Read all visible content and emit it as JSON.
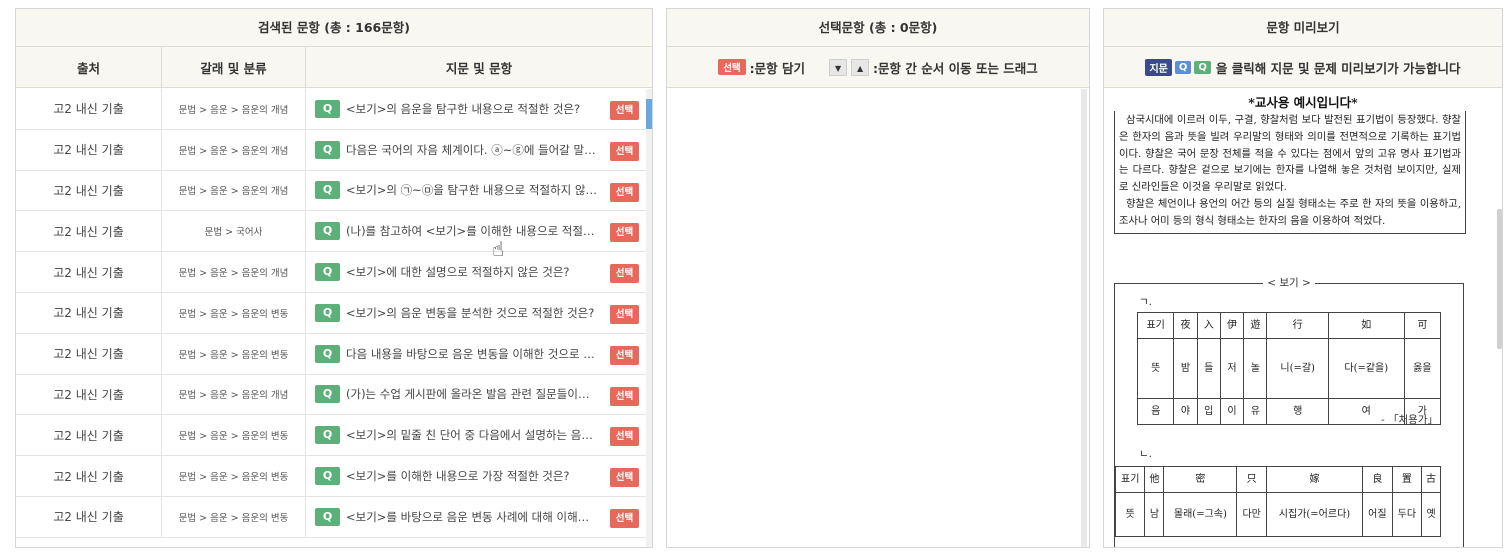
{
  "left_panel": {
    "title": "검색된 문항 (총 : 166문항)",
    "columns": [
      "출처",
      "갈래 및 분류",
      "지문 및 문항"
    ],
    "q_tag": "Q",
    "select_label": "선택",
    "rows": [
      {
        "source": "고2 내신 기출",
        "category": "문법 > 음운 > 음운의 개념",
        "question": "<보기>의 음운을 탐구한 내용으로 적절한 것은?"
      },
      {
        "source": "고2 내신 기출",
        "category": "문법 > 음운 > 음운의 개념",
        "question": "다음은 국어의 자음 체계이다. ⓐ~ⓖ에 들어갈 말로 적절한 것은?"
      },
      {
        "source": "고2 내신 기출",
        "category": "문법 > 음운 > 음운의 개념",
        "question": "<보기>의 ㉠~㉤을 탐구한 내용으로 적절하지 않은 것은?"
      },
      {
        "source": "고2 내신 기출",
        "category": "문법 > 국어사",
        "question": "(나)를 참고하여 <보기>를 이해한 내용으로 적절한 것은?"
      },
      {
        "source": "고2 내신 기출",
        "category": "문법 > 음운 > 음운의 개념",
        "question": "<보기>에 대한 설명으로 적절하지 않은 것은?"
      },
      {
        "source": "고2 내신 기출",
        "category": "문법 > 음운 > 음운의 변동",
        "question": "<보기>의 음운 변동을 분석한 것으로 적절한 것은?"
      },
      {
        "source": "고2 내신 기출",
        "category": "문법 > 음운 > 음운의 변동",
        "question": "다음 내용을 바탕으로 음운 변동을 이해한 것으로 적절한 것은?"
      },
      {
        "source": "고2 내신 기출",
        "category": "문법 > 음운 > 음운의 개념",
        "question": "(가)는 수업 게시판에 올라온 발음 관련 질문들이다. 이에 대한 답변으로 적절한 것은?"
      },
      {
        "source": "고2 내신 기출",
        "category": "문법 > 음운 > 음운의 변동",
        "question": "<보기>의 밑줄 친 단어 중 다음에서 설명하는 음운 변동이 일어나는 것은?"
      },
      {
        "source": "고2 내신 기출",
        "category": "문법 > 음운 > 음운의 변동",
        "question": "<보기>를 이해한 내용으로 가장 적절한 것은?"
      },
      {
        "source": "고2 내신 기출",
        "category": "문법 > 음운 > 음운의 변동",
        "question": "<보기>를 바탕으로 음운 변동 사례에 대해 이해한 내용으로 적절한 것은?"
      }
    ]
  },
  "middle_panel": {
    "title": "선택문항 (총 : 0문항)",
    "select_badge": "선택",
    "hint_add": ":문항 담기",
    "arrow_down": "▼",
    "arrow_up": "▲",
    "hint_order": ":문항 간 순서 이동 또는 드래그"
  },
  "right_panel": {
    "title": "문항 미리보기",
    "tag_passage": "지문",
    "tag_q1": "Q",
    "tag_q2": "Q",
    "hint": "을 클릭해 지문 및 문제 미리보기가 가능합니다",
    "preview_heading": "*교사용 예시입니다*",
    "passage": "  삼국시대에 이르러 이두, 구결, 향찰처럼 보다 발전된 표기법이 등장했다. 향찰은 한자의 음과 뜻을 빌려 우리말의 형태와 의미를 전면적으로 기록하는 표기법이다. 향찰은 국어 문장 전체를 적을 수 있다는 점에서 앞의 고유 명사 표기법과는 다르다. 향찰은 겉으로 보기에는 한자를 나열해 놓은 것처럼 보이지만, 실제로 신라인들은 이것을 우리말로 읽었다.\n  향찰은 체언이나 용언의 어간 등의 실질 형태소는 주로 한 자의 뜻을 이용하고, 조사나 어미 등의 형식 형태소는 한자의 음을 이용하여 적었다.",
    "bogi_title": "< 보기 >",
    "label_a": "ㄱ.",
    "label_b": "ㄴ.",
    "table_a": [
      [
        "표기",
        "夜",
        "入",
        "伊",
        "遊",
        "行",
        "如",
        "可"
      ],
      [
        "뜻",
        "밤",
        "들",
        "저",
        "놀",
        "니(=갈)",
        "다(=같을)",
        "옳을"
      ],
      [
        "음",
        "야",
        "입",
        "이",
        "유",
        "행",
        "여",
        "가"
      ]
    ],
    "source_a": "- 「처용가」",
    "table_b": [
      [
        "표기",
        "他",
        "密",
        "只",
        "嫁",
        "良",
        "置",
        "古"
      ],
      [
        "뜻",
        "남",
        "몰래(=그속)",
        "다만",
        "시집가(=어르다)",
        "어질",
        "두다",
        "옛"
      ]
    ]
  }
}
